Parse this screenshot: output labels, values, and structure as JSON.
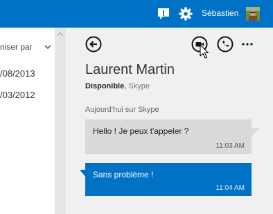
{
  "header": {
    "user_name": "Sébastien",
    "accent_color": "#0072c6",
    "icons": [
      "chat-icon",
      "gear-icon"
    ]
  },
  "list_pane": {
    "sort_label": "niser par",
    "dates": [
      "/08/2013",
      "/03/2012"
    ]
  },
  "conversation": {
    "contact_name": "Laurent Martin",
    "status": "Disponible",
    "status_separator": ",",
    "service": "Skype",
    "day_label": "Aujourd'hui sur Skype",
    "messages": [
      {
        "direction": "incoming",
        "text": "Hello ! Je peux t'appeler ?",
        "time": "11:03 AM"
      },
      {
        "direction": "outgoing",
        "text": "Sans problème !",
        "time": "11:04 AM"
      }
    ],
    "icons": [
      "back-arrow-icon",
      "video-call-icon",
      "phone-icon",
      "more-icon"
    ]
  }
}
